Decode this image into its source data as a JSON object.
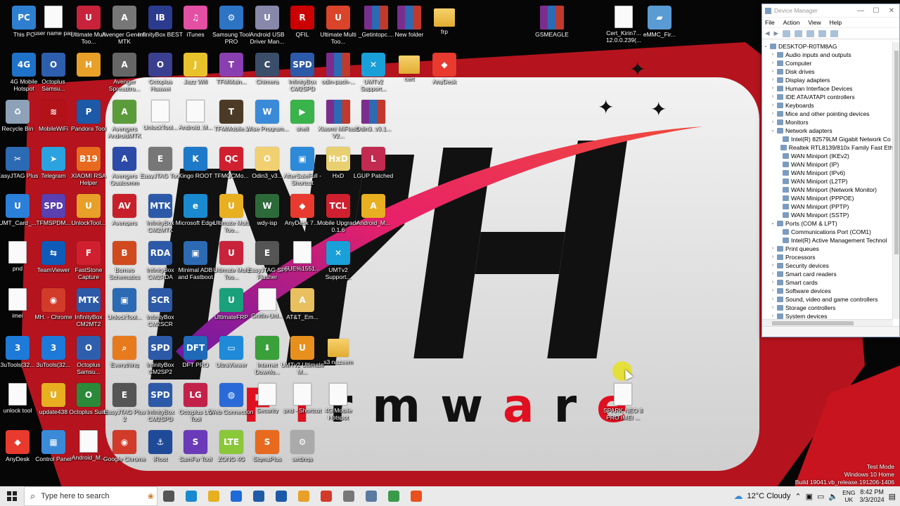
{
  "desktop": {
    "icons": [
      {
        "label": "This PC",
        "color": "#2f7fd0",
        "glyph": "PC",
        "kind": "app"
      },
      {
        "label": "user name pas",
        "color": "#fff",
        "glyph": "",
        "kind": "doc"
      },
      {
        "label": "Ultimate Multi Too...",
        "color": "#c8233b",
        "glyph": "U",
        "kind": "app"
      },
      {
        "label": "Avenger Generic MTK",
        "color": "#777",
        "glyph": "A",
        "kind": "app"
      },
      {
        "label": "InfinityBox BEST",
        "color": "#2b3b8e",
        "glyph": "IB",
        "kind": "app"
      },
      {
        "label": "iTunes",
        "color": "#e34fa3",
        "glyph": "♫",
        "kind": "app"
      },
      {
        "label": "Samsung Tool PRO",
        "color": "#2d74c4",
        "glyph": "⚙",
        "kind": "app"
      },
      {
        "label": "Android USB Driver Man...",
        "color": "#88a",
        "glyph": "U",
        "kind": "app"
      },
      {
        "label": "QFIL",
        "color": "#c00",
        "glyph": "R",
        "kind": "app"
      },
      {
        "label": "Ultimate Multi Too...",
        "color": "#d9442a",
        "glyph": "U",
        "kind": "app"
      },
      {
        "label": "_Getintopc....",
        "color": "",
        "glyph": "",
        "kind": "rar"
      },
      {
        "label": "New folder",
        "color": "",
        "glyph": "",
        "kind": "rar"
      },
      {
        "label": "frp",
        "color": "",
        "glyph": "",
        "kind": "folder"
      },
      {
        "label": "GSMEAGLE",
        "color": "",
        "glyph": "",
        "kind": "rar"
      },
      {
        "label": "Cert_Kirin7... 12.0.0.239(...",
        "color": "#fff",
        "glyph": "",
        "kind": "doc"
      },
      {
        "label": "eMMC_Fir...",
        "color": "#5a9bd3",
        "glyph": "▰",
        "kind": "app"
      },
      {
        "label": "4G Mobile Hotspot",
        "color": "#1e72c8",
        "glyph": "4G",
        "kind": "app"
      },
      {
        "label": "Octoplus Samsu...",
        "color": "#2e5fae",
        "glyph": "O",
        "kind": "app"
      },
      {
        "label": "",
        "color": "#e8a028",
        "glyph": "H",
        "kind": "app"
      },
      {
        "label": "Avenger Spreadtru...",
        "color": "#666",
        "glyph": "A",
        "kind": "app"
      },
      {
        "label": "Octoplus Huawei",
        "color": "#3b3f8f",
        "glyph": "O",
        "kind": "app"
      },
      {
        "label": "Jazz Wifi",
        "color": "#e8c22a",
        "glyph": "J",
        "kind": "app"
      },
      {
        "label": "TFMMain...",
        "color": "#8a3fb0",
        "glyph": "T",
        "kind": "app"
      },
      {
        "label": "Chimera",
        "color": "#3a4e6a",
        "glyph": "C",
        "kind": "app"
      },
      {
        "label": "InfinityBox CM2SPD",
        "color": "#2d5aa8",
        "glyph": "SPD",
        "kind": "app"
      },
      {
        "label": "odin-pach-...",
        "color": "",
        "glyph": "",
        "kind": "rar"
      },
      {
        "label": "UMTv2 Support...",
        "color": "#1aa0d8",
        "glyph": "✕",
        "kind": "app"
      },
      {
        "label": "cert",
        "color": "",
        "glyph": "",
        "kind": "folder"
      },
      {
        "label": "AnyDesk",
        "color": "#e83a2e",
        "glyph": "◆",
        "kind": "app"
      },
      {
        "label": "Recycle Bin",
        "color": "#8da2b8",
        "glyph": "♻",
        "kind": "app"
      },
      {
        "label": "MobileWiFi",
        "color": "#b31218",
        "glyph": "≋",
        "kind": "app"
      },
      {
        "label": "Pandora Tool",
        "color": "#1c5aa8",
        "glyph": "P",
        "kind": "app"
      },
      {
        "label": "Avengers AndroidMTK",
        "color": "#5b9c3a",
        "glyph": "A",
        "kind": "app"
      },
      {
        "label": "UnlockTool...",
        "color": "#fff",
        "glyph": "",
        "kind": "doc"
      },
      {
        "label": "Android_M...",
        "color": "#fff",
        "glyph": "",
        "kind": "doc"
      },
      {
        "label": "TFMMobile...",
        "color": "#4b3a25",
        "glyph": "T",
        "kind": "app"
      },
      {
        "label": "Wise Program...",
        "color": "#3a8ad8",
        "glyph": "W",
        "kind": "app"
      },
      {
        "label": "shell",
        "color": "#3ab34a",
        "glyph": "▶",
        "kind": "app"
      },
      {
        "label": "Xiaomi MiFlash V2...",
        "color": "",
        "glyph": "",
        "kind": "rar"
      },
      {
        "label": "Odin3_v3.1...",
        "color": "",
        "glyph": "",
        "kind": "rar"
      },
      {
        "label": "EasyJTAG Plus",
        "color": "#2c6ab3",
        "glyph": "✂",
        "kind": "app"
      },
      {
        "label": "Telegram",
        "color": "#2aa3e0",
        "glyph": "➤",
        "kind": "app"
      },
      {
        "label": "XIAOMI RSA Helper",
        "color": "#e86a1e",
        "glyph": "B19",
        "kind": "app"
      },
      {
        "label": "Avengers Qualcomm",
        "color": "#2c4aa8",
        "glyph": "A",
        "kind": "app"
      },
      {
        "label": "EasyJTAG Tool",
        "color": "#777",
        "glyph": "E",
        "kind": "app"
      },
      {
        "label": "Kingo ROOT",
        "color": "#1e7ac8",
        "glyph": "K",
        "kind": "app"
      },
      {
        "label": "TFMQCMo...",
        "color": "#d02030",
        "glyph": "QC",
        "kind": "app"
      },
      {
        "label": "Odin3_v3...",
        "color": "#f0d070",
        "glyph": "O",
        "kind": "app"
      },
      {
        "label": "AfterSaleFull - Shortcut",
        "color": "#2c8ad8",
        "glyph": "▣",
        "kind": "app"
      },
      {
        "label": "HxD",
        "color": "#e8d070",
        "glyph": "HxD",
        "kind": "app"
      },
      {
        "label": "LGUP Patched",
        "color": "#c22a50",
        "glyph": "L",
        "kind": "app"
      },
      {
        "label": "UMT_Card_...",
        "color": "#2a7fd8",
        "glyph": "U",
        "kind": "app"
      },
      {
        "label": "TFMSPDM...",
        "color": "#5a40b0",
        "glyph": "SPD",
        "kind": "app"
      },
      {
        "label": "UnlockTool...",
        "color": "#e8a028",
        "glyph": "U",
        "kind": "app"
      },
      {
        "label": "Avengers",
        "color": "#c8202a",
        "glyph": "AV",
        "kind": "app"
      },
      {
        "label": "InfinityBox CM2MTK",
        "color": "#2d5aa8",
        "glyph": "MTK",
        "kind": "app"
      },
      {
        "label": "Microsoft Edge",
        "color": "#1a8ad0",
        "glyph": "e",
        "kind": "app"
      },
      {
        "label": "Ultimate Multi Too...",
        "color": "#e8b020",
        "glyph": "U",
        "kind": "app"
      },
      {
        "label": "wdy-isp",
        "color": "#2c6a3a",
        "glyph": "W",
        "kind": "app"
      },
      {
        "label": "AnyDesk 7....",
        "color": "#e83a2e",
        "glyph": "◆",
        "kind": "app"
      },
      {
        "label": "Mobile Upgrade 0.1.6",
        "color": "#d02030",
        "glyph": "TCL",
        "kind": "app"
      },
      {
        "label": "Android_M...",
        "color": "#e8b020",
        "glyph": "A",
        "kind": "app"
      },
      {
        "label": "pnd",
        "color": "#fff",
        "glyph": "",
        "kind": "doc"
      },
      {
        "label": "TeamViewer",
        "color": "#0e5cb8",
        "glyph": "⇆",
        "kind": "app"
      },
      {
        "label": "FastStone Capture",
        "color": "#d02030",
        "glyph": "F",
        "kind": "app"
      },
      {
        "label": "Borneo Schematics",
        "color": "#d04a1e",
        "glyph": "B",
        "kind": "app"
      },
      {
        "label": "InfinityBox CM2RDA",
        "color": "#2d5aa8",
        "glyph": "RDA",
        "kind": "app"
      },
      {
        "label": "Minimal ADB and Fastboot",
        "color": "#2c6ab3",
        "glyph": "▣",
        "kind": "app"
      },
      {
        "label": "Ultimate Multi Too...",
        "color": "#c8233b",
        "glyph": "U",
        "kind": "app"
      },
      {
        "label": "EasyJTAG SPI Flasher",
        "color": "#555",
        "glyph": "E",
        "kind": "app"
      },
      {
        "label": "6UE%1551...",
        "color": "#fff",
        "glyph": "",
        "kind": "doc"
      },
      {
        "label": "UMTv2 Support...",
        "color": "#1aa0d8",
        "glyph": "✕",
        "kind": "app"
      },
      {
        "label": "imei",
        "color": "#fff",
        "glyph": "",
        "kind": "doc"
      },
      {
        "label": "MH. - Chrome",
        "color": "#d23a2a",
        "glyph": "◉",
        "kind": "app"
      },
      {
        "label": "InfinityBox CM2MT2",
        "color": "#2d5aa8",
        "glyph": "MTK",
        "kind": "app"
      },
      {
        "label": "UnlockTool...",
        "color": "#2c6ab3",
        "glyph": "▣",
        "kind": "app"
      },
      {
        "label": "InfinityBox CM2SCR",
        "color": "#2d5aa8",
        "glyph": "SCR",
        "kind": "app"
      },
      {
        "label": "UltimateFRP",
        "color": "#1aa07a",
        "glyph": "U",
        "kind": "app"
      },
      {
        "label": "Griffin-Unl...",
        "color": "#fff",
        "glyph": "",
        "kind": "doc"
      },
      {
        "label": "AT&T_Em...",
        "color": "#e8c060",
        "glyph": "A",
        "kind": "app"
      },
      {
        "label": "3uTools(32...",
        "color": "#1e7ad8",
        "glyph": "3",
        "kind": "app"
      },
      {
        "label": "3uTools(32...",
        "color": "#1e7ad8",
        "glyph": "3",
        "kind": "app"
      },
      {
        "label": "Octoplus Samsu...",
        "color": "#2e5fae",
        "glyph": "O",
        "kind": "app"
      },
      {
        "label": "Everything",
        "color": "#e87a1e",
        "glyph": "⌕",
        "kind": "app"
      },
      {
        "label": "InfinityBox CM2SP2",
        "color": "#2d5aa8",
        "glyph": "SPD",
        "kind": "app"
      },
      {
        "label": "DFT PRO",
        "color": "#1e6ab8",
        "glyph": "DFT",
        "kind": "app"
      },
      {
        "label": "UltraViewer",
        "color": "#1e8ad8",
        "glyph": "▭",
        "kind": "app"
      },
      {
        "label": "Internet Downlo...",
        "color": "#3aa03a",
        "glyph": "⬇",
        "kind": "app"
      },
      {
        "label": "UMTv2 Ultimate M...",
        "color": "#e8901e",
        "glyph": "U",
        "kind": "app"
      },
      {
        "label": "s3 nazeem",
        "color": "",
        "glyph": "",
        "kind": "folder"
      },
      {
        "label": "unlock tool",
        "color": "#fff",
        "glyph": "",
        "kind": "doc"
      },
      {
        "label": "update438",
        "color": "#e8b020",
        "glyph": "U",
        "kind": "app"
      },
      {
        "label": "Octoplus Suite",
        "color": "#2a8a3a",
        "glyph": "O",
        "kind": "app"
      },
      {
        "label": "EasyJTAG Plus 2",
        "color": "#555",
        "glyph": "E",
        "kind": "app"
      },
      {
        "label": "InfinityBox CM2SPD",
        "color": "#2d5aa8",
        "glyph": "SPD",
        "kind": "app"
      },
      {
        "label": "Octoplus LG Tool",
        "color": "#c2224a",
        "glyph": "LG",
        "kind": "app"
      },
      {
        "label": "Web Connection",
        "color": "#2a6ad8",
        "glyph": "◍",
        "kind": "app"
      },
      {
        "label": "Security",
        "color": "#fff",
        "glyph": "",
        "kind": "doc"
      },
      {
        "label": "pnd - Shortcut",
        "color": "#fff",
        "glyph": "",
        "kind": "doc"
      },
      {
        "label": "4G Mobile Hotspot",
        "color": "#fff",
        "glyph": "",
        "kind": "doc"
      },
      {
        "label": "SPARK NEO 8 PRO IMEI ...",
        "color": "#fff",
        "glyph": "",
        "kind": "doc"
      },
      {
        "label": "AnyDesk",
        "color": "#e83a2e",
        "glyph": "◆",
        "kind": "app"
      },
      {
        "label": "Control Panel",
        "color": "#3a8ad8",
        "glyph": "▦",
        "kind": "app"
      },
      {
        "label": "Android_M...",
        "color": "#fff",
        "glyph": "",
        "kind": "doc"
      },
      {
        "label": "Google Chrome",
        "color": "#d23a2a",
        "glyph": "◉",
        "kind": "app"
      },
      {
        "label": "iRoot",
        "color": "#1e4a98",
        "glyph": "⚓",
        "kind": "app"
      },
      {
        "label": "SamFw Tool",
        "color": "#6a3ab8",
        "glyph": "S",
        "kind": "app"
      },
      {
        "label": "ZONG 4G",
        "color": "#8ac83a",
        "glyph": "LTE",
        "kind": "app"
      },
      {
        "label": "SigmaPlus",
        "color": "#e86a1e",
        "glyph": "S",
        "kind": "app"
      },
      {
        "label": "settings",
        "color": "#aaa",
        "glyph": "⚙",
        "kind": "app"
      }
    ],
    "wallpaper": {
      "brand": "MH",
      "word": "Firmware"
    }
  },
  "device_manager": {
    "title": "Device Manager",
    "menu": [
      "File",
      "Action",
      "View",
      "Help"
    ],
    "root": "DESKTOP-R0TM8AG",
    "tree": [
      {
        "label": "Audio inputs and outputs",
        "level": 1,
        "caret": "›"
      },
      {
        "label": "Computer",
        "level": 1,
        "caret": "›"
      },
      {
        "label": "Disk drives",
        "level": 1,
        "caret": "›"
      },
      {
        "label": "Display adapters",
        "level": 1,
        "caret": "›"
      },
      {
        "label": "Human Interface Devices",
        "level": 1,
        "caret": "›"
      },
      {
        "label": "IDE ATA/ATAPI controllers",
        "level": 1,
        "caret": "›"
      },
      {
        "label": "Keyboards",
        "level": 1,
        "caret": "›"
      },
      {
        "label": "Mice and other pointing devices",
        "level": 1,
        "caret": "›"
      },
      {
        "label": "Monitors",
        "level": 1,
        "caret": "›"
      },
      {
        "label": "Network adapters",
        "level": 1,
        "caret": "⌄"
      },
      {
        "label": "Intel(R) 82579LM Gigabit Network Co",
        "level": 2,
        "caret": ""
      },
      {
        "label": "Realtek RTL8139/810x Family Fast Eth",
        "level": 2,
        "caret": ""
      },
      {
        "label": "WAN Miniport (IKEv2)",
        "level": 2,
        "caret": ""
      },
      {
        "label": "WAN Miniport (IP)",
        "level": 2,
        "caret": ""
      },
      {
        "label": "WAN Miniport (IPv6)",
        "level": 2,
        "caret": ""
      },
      {
        "label": "WAN Miniport (L2TP)",
        "level": 2,
        "caret": ""
      },
      {
        "label": "WAN Miniport (Network Monitor)",
        "level": 2,
        "caret": ""
      },
      {
        "label": "WAN Miniport (PPPOE)",
        "level": 2,
        "caret": ""
      },
      {
        "label": "WAN Miniport (PPTP)",
        "level": 2,
        "caret": ""
      },
      {
        "label": "WAN Miniport (SSTP)",
        "level": 2,
        "caret": ""
      },
      {
        "label": "Ports (COM & LPT)",
        "level": 1,
        "caret": "⌄"
      },
      {
        "label": "Communications Port (COM1)",
        "level": 2,
        "caret": ""
      },
      {
        "label": "Intel(R) Active Management Technol",
        "level": 2,
        "caret": ""
      },
      {
        "label": "Print queues",
        "level": 1,
        "caret": "›"
      },
      {
        "label": "Processors",
        "level": 1,
        "caret": "›"
      },
      {
        "label": "Security devices",
        "level": 1,
        "caret": "›"
      },
      {
        "label": "Smart card readers",
        "level": 1,
        "caret": "›"
      },
      {
        "label": "Smart cards",
        "level": 1,
        "caret": "›"
      },
      {
        "label": "Software devices",
        "level": 1,
        "caret": "›"
      },
      {
        "label": "Sound, video and game controllers",
        "level": 1,
        "caret": "›"
      },
      {
        "label": "Storage controllers",
        "level": 1,
        "caret": "›"
      },
      {
        "label": "System devices",
        "level": 1,
        "caret": "›"
      }
    ]
  },
  "taskbar": {
    "search_placeholder": "Type here to search",
    "apps": [
      {
        "name": "task-view",
        "color": "#555"
      },
      {
        "name": "edge",
        "color": "#1a8ad0"
      },
      {
        "name": "file-explorer",
        "color": "#e8b020"
      },
      {
        "name": "mail",
        "color": "#1e6ad8"
      },
      {
        "name": "app-blue",
        "color": "#1e5aa8"
      },
      {
        "name": "pandora",
        "color": "#1c5aa8"
      },
      {
        "name": "app-orange",
        "color": "#e8a028"
      },
      {
        "name": "chrome",
        "color": "#d23a2a"
      },
      {
        "name": "app-gray",
        "color": "#777"
      },
      {
        "name": "app-window",
        "color": "#5a7aa0"
      },
      {
        "name": "app-green",
        "color": "#3a9a4a"
      },
      {
        "name": "app-red",
        "color": "#e8501e"
      }
    ],
    "weather": "12°C  Cloudy",
    "lang_top": "ENG",
    "lang_bottom": "UK",
    "time": "8:42 PM",
    "date": "3/3/2024"
  },
  "watermark": {
    "line1": "Test Mode",
    "line2": "Windows 10 Home",
    "line3": "Build 19041.vb_release.191206-1406"
  }
}
